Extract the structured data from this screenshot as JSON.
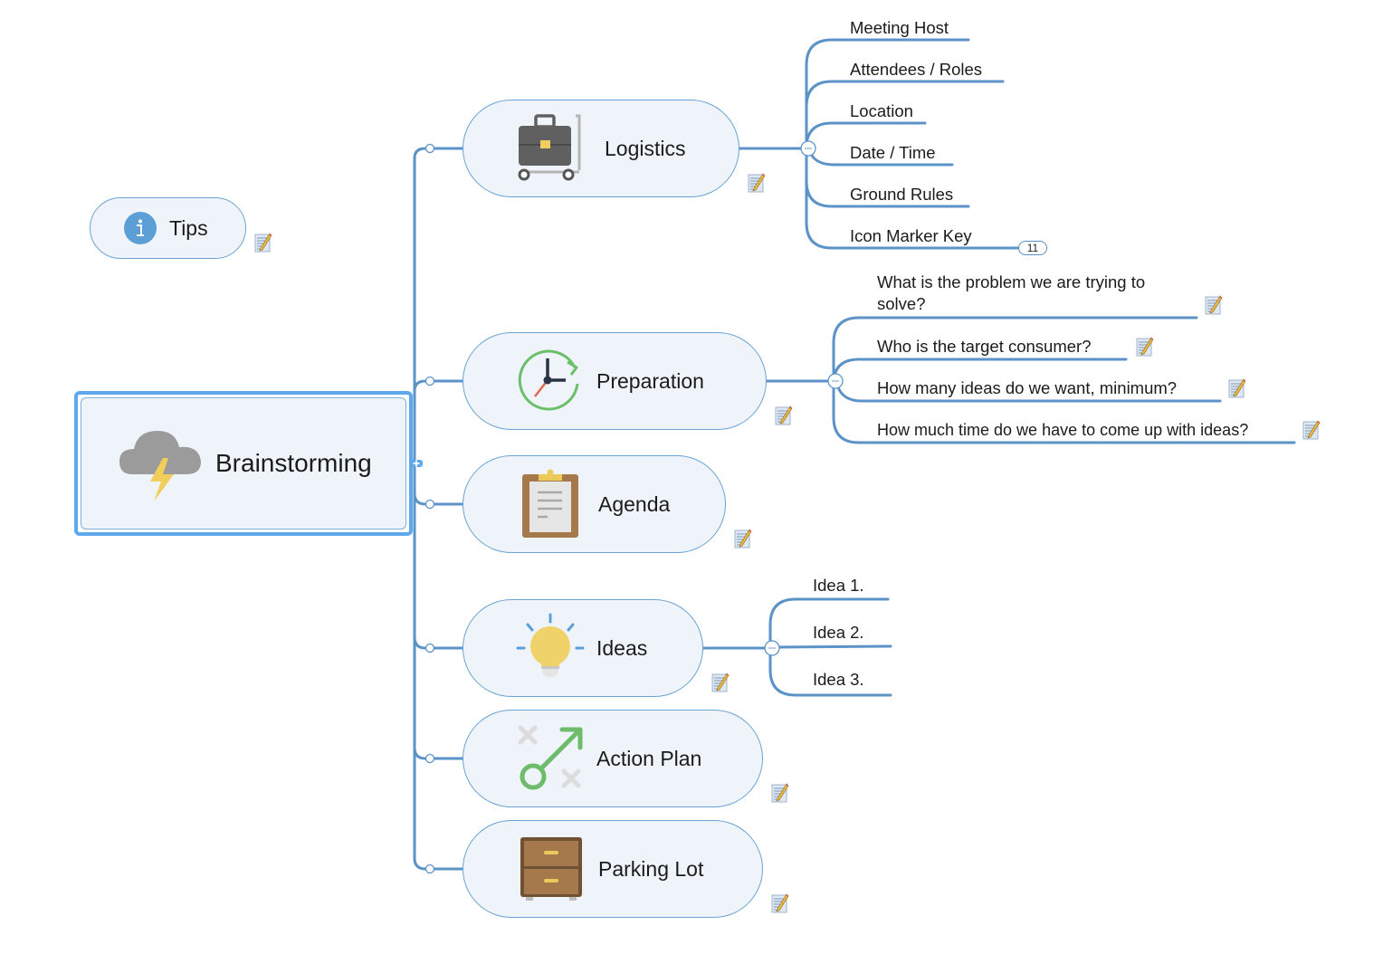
{
  "map": {
    "central": {
      "label": "Brainstorming",
      "icon": "storm-cloud-icon"
    },
    "floating": {
      "label": "Tips",
      "icon": "info-icon",
      "has_note": true
    },
    "branches": [
      {
        "id": "logistics",
        "label": "Logistics",
        "icon": "luggage-cart-icon",
        "has_note": true,
        "children": [
          {
            "label": "Meeting Host"
          },
          {
            "label": "Attendees / Roles"
          },
          {
            "label": "Location"
          },
          {
            "label": "Date / Time"
          },
          {
            "label": "Ground Rules"
          },
          {
            "label": "Icon Marker Key",
            "collapsed_count": "11"
          }
        ]
      },
      {
        "id": "preparation",
        "label": "Preparation",
        "icon": "clock-refresh-icon",
        "has_note": true,
        "children": [
          {
            "label_line1": "What is the problem we are trying to",
            "label_line2": "solve?",
            "has_note": true
          },
          {
            "label": "Who is the target consumer?",
            "has_note": true
          },
          {
            "label": "How many ideas do we want, minimum?",
            "has_note": true
          },
          {
            "label": "How much time do we have to come up with ideas?",
            "has_note": true
          }
        ]
      },
      {
        "id": "agenda",
        "label": "Agenda",
        "icon": "clipboard-icon",
        "has_note": true,
        "children": []
      },
      {
        "id": "ideas",
        "label": "Ideas",
        "icon": "lightbulb-icon",
        "has_note": true,
        "children": [
          {
            "label": "Idea 1."
          },
          {
            "label": "Idea 2."
          },
          {
            "label": "Idea 3."
          }
        ]
      },
      {
        "id": "action-plan",
        "label": "Action Plan",
        "icon": "strategy-arrow-icon",
        "has_note": true,
        "children": []
      },
      {
        "id": "parking-lot",
        "label": "Parking Lot",
        "icon": "file-cabinet-icon",
        "has_note": true,
        "children": []
      }
    ]
  },
  "colors": {
    "line": "#5b93c9",
    "node_fill": "#eff4fa",
    "node_border": "#6aa3d4",
    "selection": "#5ea8ee"
  }
}
